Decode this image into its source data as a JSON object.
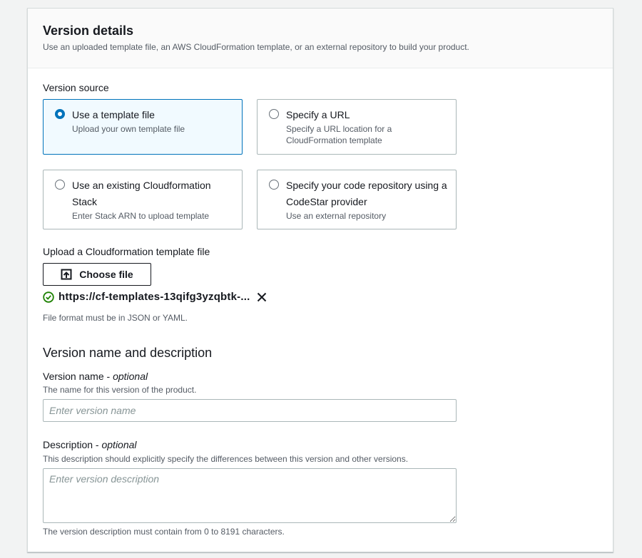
{
  "panel": {
    "title": "Version details",
    "description": "Use an uploaded template file, an AWS CloudFormation template, or an external repository to build your product."
  },
  "version_source": {
    "label": "Version source",
    "options": [
      {
        "title": "Use a template file",
        "description": "Upload your own template file",
        "selected": true
      },
      {
        "title": "Specify a URL",
        "description": "Specify a URL location for a CloudFormation template",
        "selected": false
      },
      {
        "title": "Use an existing Cloudformation Stack",
        "description": "Enter Stack ARN to upload template",
        "selected": false
      },
      {
        "title": "Specify your code repository using a CodeStar provider",
        "description": "Use an external repository",
        "selected": false
      }
    ]
  },
  "upload": {
    "label": "Upload a Cloudformation template file",
    "button_label": "Choose file",
    "file_name": "https://cf-templates-13qifg3yzqbtk-...",
    "hint": "File format must be in JSON or YAML."
  },
  "name_section": {
    "heading": "Version name and description",
    "version_name": {
      "label": "Version name",
      "optional": "optional",
      "hint": "The name for this version of the product.",
      "placeholder": "Enter version name",
      "value": ""
    },
    "description": {
      "label": "Description",
      "optional": "optional",
      "hint": "This description should explicitly specify the differences between this version and other versions.",
      "placeholder": "Enter version description",
      "value": "",
      "constraint": "The version description must contain from 0 to 8191 characters."
    }
  },
  "icons": {
    "upload": "upload-icon",
    "success": "status-success-icon",
    "remove": "close-icon"
  },
  "colors": {
    "accent": "#0073bb",
    "selected_bg": "#f1faff",
    "success": "#1d8102"
  }
}
